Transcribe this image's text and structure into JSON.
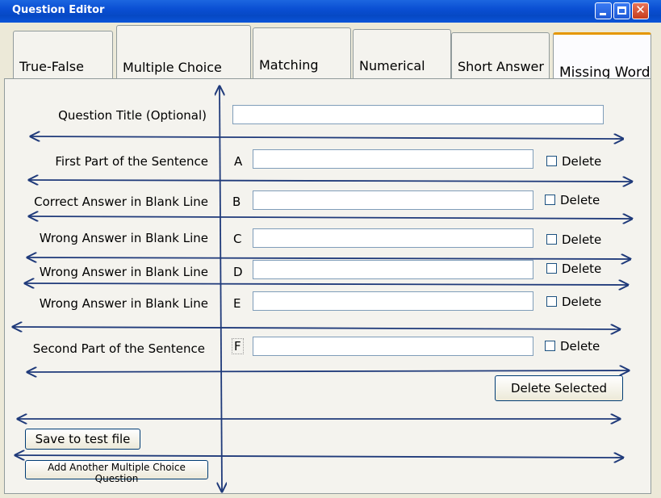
{
  "window": {
    "title": "Question Editor",
    "controls": {
      "minimize": "minimize-icon",
      "maximize": "maximize-icon",
      "close": "close-icon"
    }
  },
  "tabs": [
    {
      "label": "True-False"
    },
    {
      "label": "Multiple Choice"
    },
    {
      "label": "Matching"
    },
    {
      "label": "Numerical"
    },
    {
      "label": "Short Answer"
    },
    {
      "label": "Missing Word",
      "active": true
    }
  ],
  "form": {
    "title_label": "Question Title (Optional)",
    "title_value": "",
    "rows": [
      {
        "label": "First Part of the Sentence",
        "letter": "A",
        "value": "",
        "delete_label": "Delete",
        "checked": false
      },
      {
        "label": "Correct Answer in Blank Line",
        "letter": "B",
        "value": "",
        "delete_label": "Delete",
        "checked": false
      },
      {
        "label": "Wrong Answer in Blank Line",
        "letter": "C",
        "value": "",
        "delete_label": "Delete",
        "checked": false
      },
      {
        "label": "Wrong Answer in Blank Line",
        "letter": "D",
        "value": "",
        "delete_label": "Delete",
        "checked": false
      },
      {
        "label": "Wrong Answer in Blank Line",
        "letter": "E",
        "value": "",
        "delete_label": "Delete",
        "checked": false
      },
      {
        "label": "Second Part of the Sentence",
        "letter": "F",
        "value": "",
        "delete_label": "Delete",
        "checked": false
      }
    ]
  },
  "buttons": {
    "delete_selected": "Delete Selected",
    "save": "Save to test file",
    "add_another": "Add Another Multiple Choice Question"
  },
  "annotation": {
    "color": "#1F3A7A"
  }
}
